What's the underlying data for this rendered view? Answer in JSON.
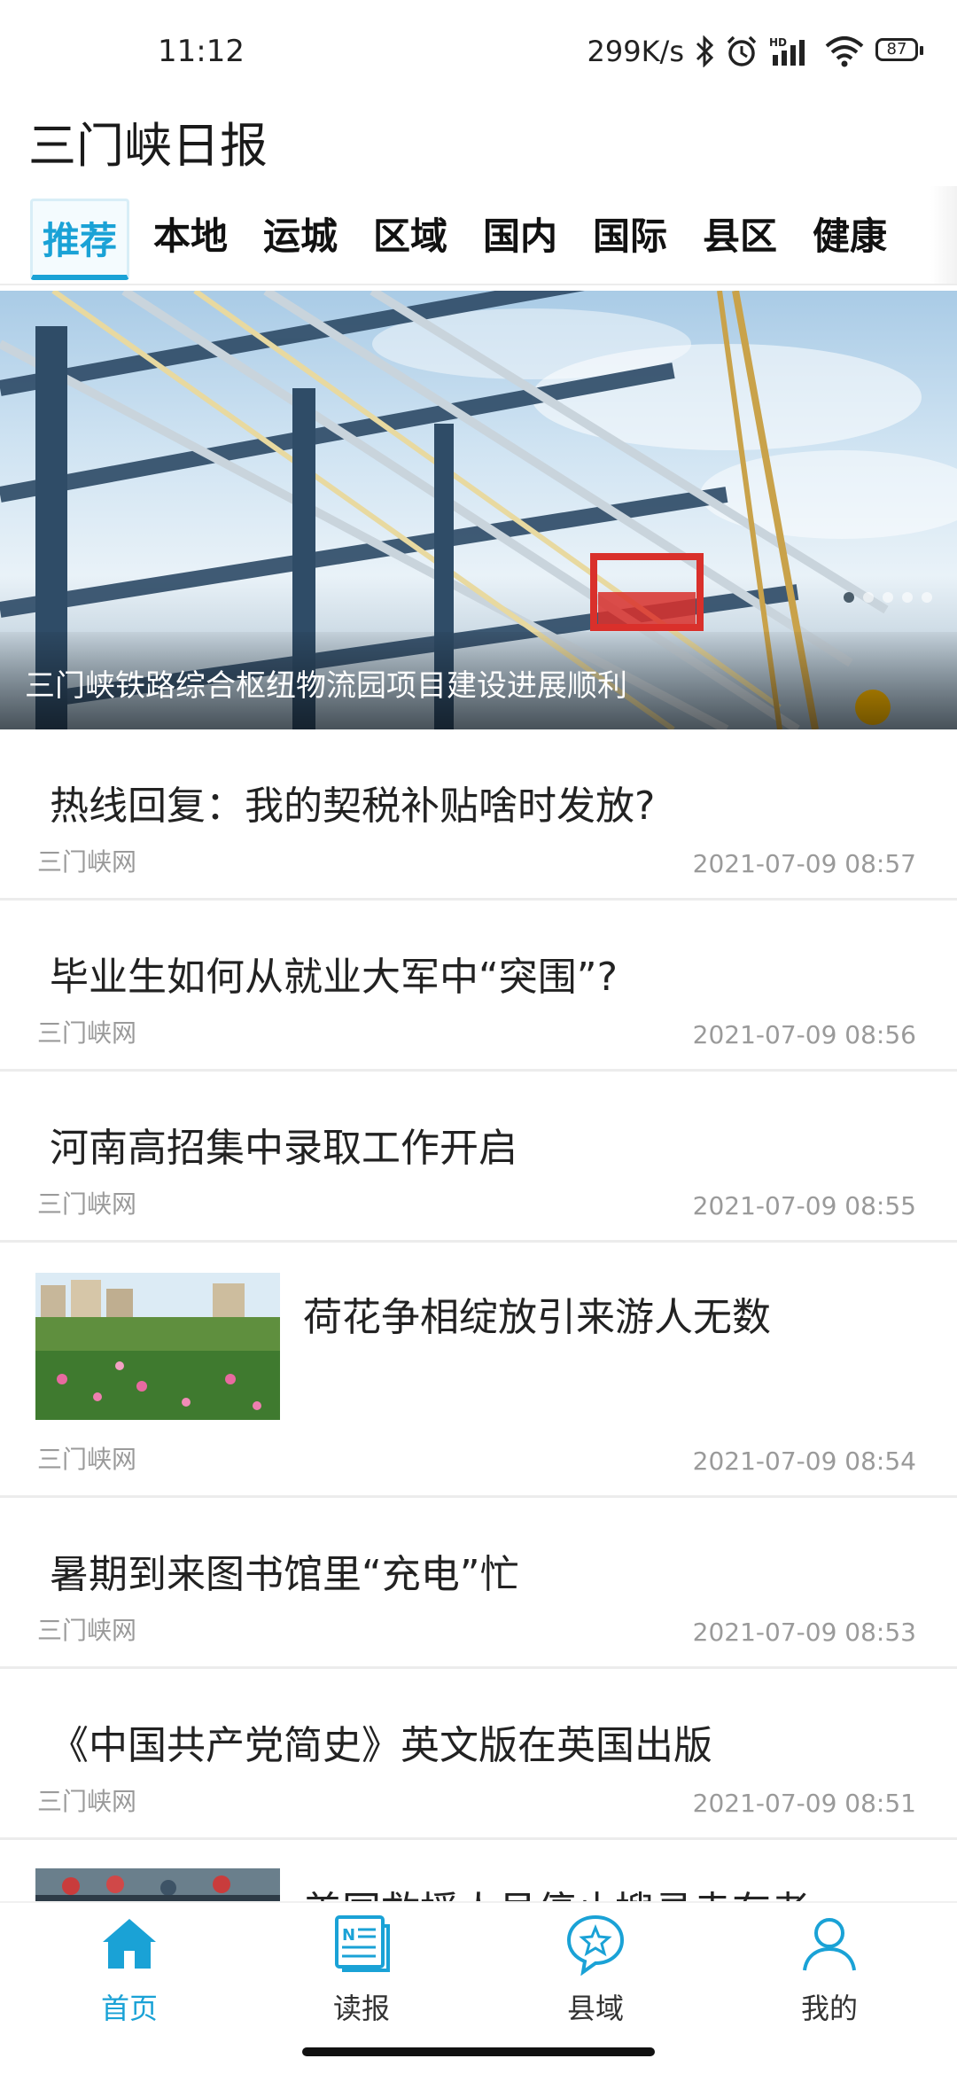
{
  "status": {
    "time": "11:12",
    "speed": "299K/s",
    "battery": "87",
    "icons": [
      "bluetooth-icon",
      "alarm-icon",
      "hd-signal-icon",
      "wifi-icon",
      "battery-icon"
    ]
  },
  "app": {
    "title": "三门峡日报"
  },
  "tabs": [
    {
      "label": "推荐",
      "active": true
    },
    {
      "label": "本地",
      "active": false
    },
    {
      "label": "运城",
      "active": false
    },
    {
      "label": "区域",
      "active": false
    },
    {
      "label": "国内",
      "active": false
    },
    {
      "label": "国际",
      "active": false
    },
    {
      "label": "县区",
      "active": false
    },
    {
      "label": "健康",
      "active": false
    }
  ],
  "banner": {
    "caption": "三门峡铁路综合枢纽物流园项目建设进展顺利",
    "slide_count": 5,
    "current_slide": 1
  },
  "news": [
    {
      "title": "热线回复：我的契税补贴啥时发放?",
      "source": "三门峡网",
      "date": "2021-07-09 08:57"
    },
    {
      "title": "毕业生如何从就业大军中“突围”?",
      "source": "三门峡网",
      "date": "2021-07-09 08:56"
    },
    {
      "title": "河南高招集中录取工作开启",
      "source": "三门峡网",
      "date": "2021-07-09 08:55"
    },
    {
      "title": "荷花争相绽放引来游人无数",
      "source": "三门峡网",
      "date": "2021-07-09 08:54",
      "has_image": true
    },
    {
      "title": "暑期到来图书馆里“充电”忙",
      "source": "三门峡网",
      "date": "2021-07-09 08:53"
    },
    {
      "title": "《中国共产党简史》英文版在英国出版",
      "source": "三门峡网",
      "date": "2021-07-09 08:51"
    },
    {
      "title": "美国救援人员停止搜寻幸存者",
      "has_image": true
    }
  ],
  "bottom_nav": [
    {
      "label": "首页",
      "icon": "home-icon",
      "active": true
    },
    {
      "label": "读报",
      "icon": "newspaper-icon",
      "active": false
    },
    {
      "label": "县域",
      "icon": "star-chat-icon",
      "active": false
    },
    {
      "label": "我的",
      "icon": "user-icon",
      "active": false
    }
  ],
  "colors": {
    "accent": "#1aa2d6",
    "meta_text": "#9a9a9a",
    "divider": "#ececec"
  }
}
